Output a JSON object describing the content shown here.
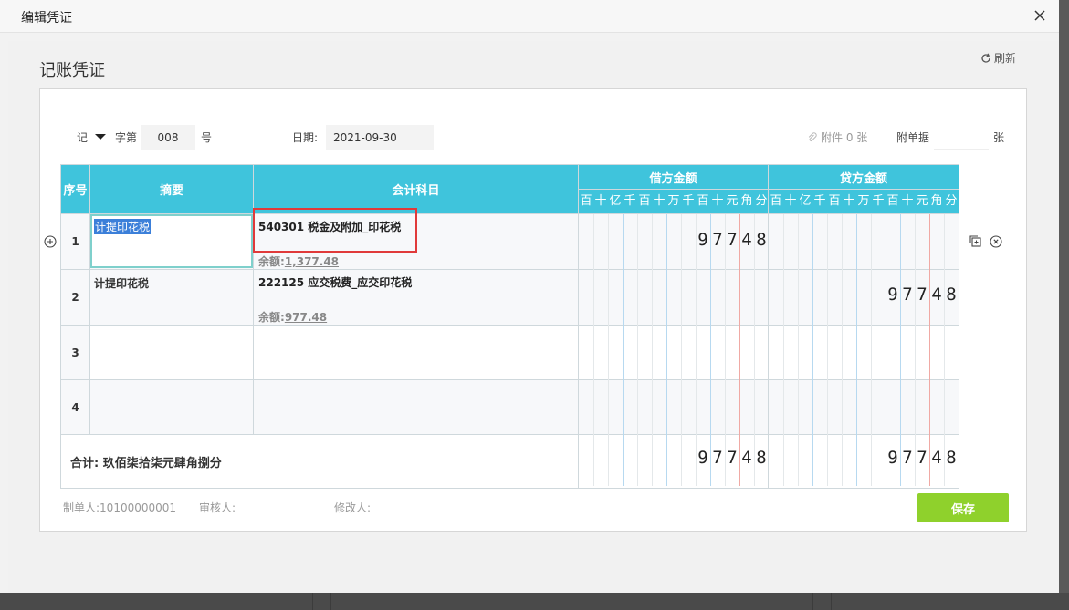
{
  "dialog": {
    "title": "编辑凭证"
  },
  "page": {
    "title": "记账凭证",
    "refresh_label": "刷新"
  },
  "voucher": {
    "word_type": "记",
    "zidi_label": "字第",
    "number": "008",
    "hao_label": "号",
    "date_label": "日期:",
    "date_value": "2021-09-30",
    "attachment_label": "附件 0 张",
    "attach_doc_label": "附单据",
    "attach_doc_value": "",
    "zhang_label": "张"
  },
  "table": {
    "headers": {
      "seq": "序号",
      "summary": "摘要",
      "subject": "会计科目",
      "debit": "借方金额",
      "credit": "贷方金额"
    },
    "digit_headers": [
      "百",
      "十",
      "亿",
      "千",
      "百",
      "十",
      "万",
      "千",
      "百",
      "十",
      "元",
      "角",
      "分"
    ],
    "rows": [
      {
        "seq": "1",
        "summary": "计提印花税",
        "subject": "540301 税金及附加_印花税",
        "balance_label": "余额:",
        "balance_value": "1,377.48",
        "debit": "97748",
        "credit": ""
      },
      {
        "seq": "2",
        "summary": "计提印花税",
        "subject": "222125 应交税费_应交印花税",
        "balance_label": "余额:",
        "balance_value": "977.48",
        "debit": "",
        "credit": "97748"
      },
      {
        "seq": "3",
        "summary": "",
        "subject": "",
        "debit": "",
        "credit": ""
      },
      {
        "seq": "4",
        "summary": "",
        "subject": "",
        "debit": "",
        "credit": ""
      }
    ],
    "total": {
      "label": "合计:",
      "text": "玖佰柒拾柒元肆角捌分",
      "debit": "97748",
      "credit": "97748"
    }
  },
  "footer": {
    "maker": "制单人:10100000001",
    "reviewer": "审核人:",
    "modifier": "修改人:",
    "save_label": "保存"
  },
  "colors": {
    "header": "#3fc4dc",
    "save": "#8fd12c",
    "highlight": "#e03a3a"
  },
  "icons": [
    "close-icon",
    "refresh-icon",
    "caret-down-icon",
    "paperclip-icon",
    "add-row-icon",
    "copy-row-icon",
    "delete-row-icon"
  ]
}
